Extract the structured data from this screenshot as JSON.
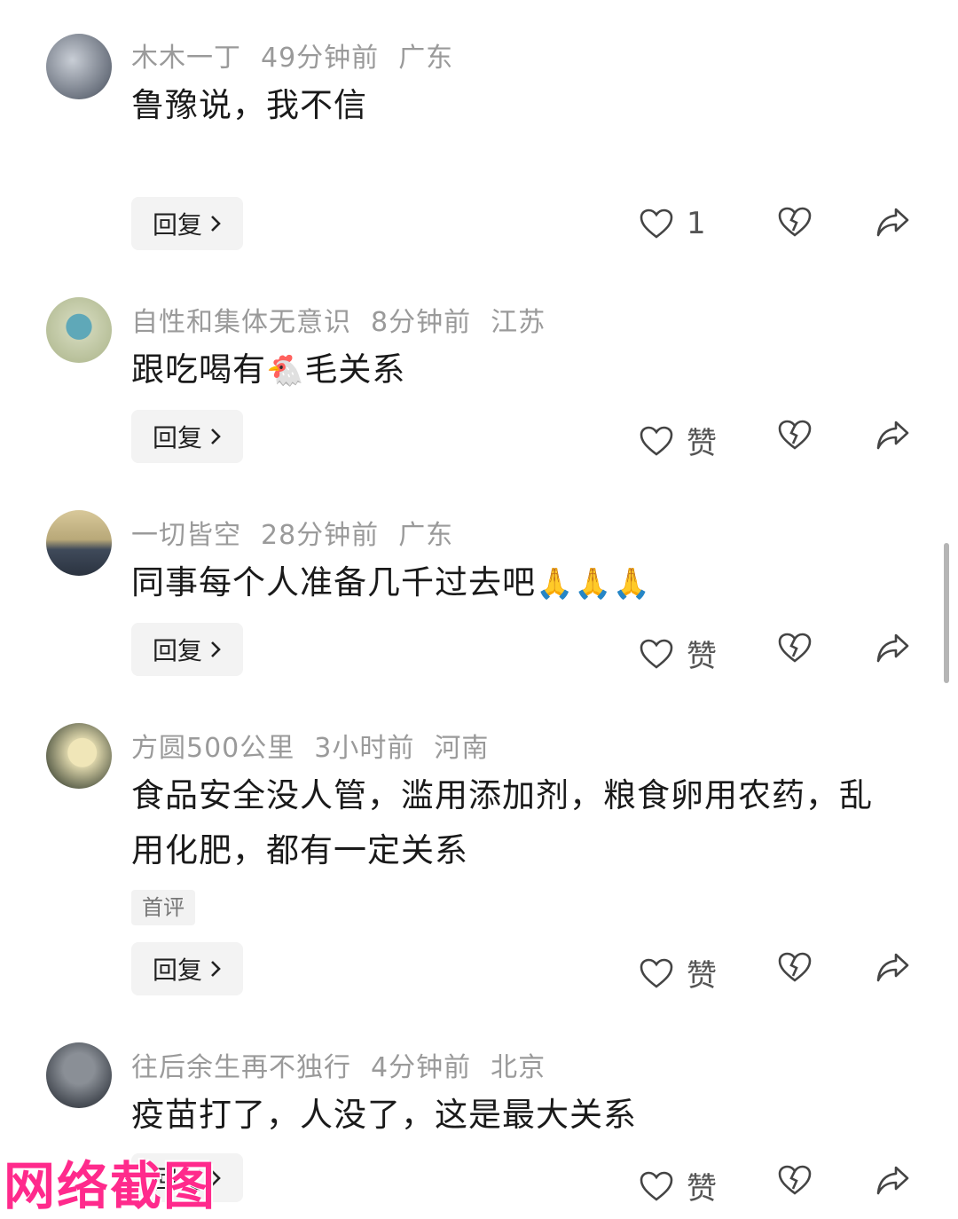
{
  "comments": [
    {
      "author": "木木一丁",
      "time": "49分钟前",
      "location": "广东",
      "text": "鲁豫说，我不信",
      "reply_label": "回复",
      "like_label": "1"
    },
    {
      "author": "自性和集体无意识",
      "time": "8分钟前",
      "location": "江苏",
      "text_before": "跟吃喝有",
      "emoji": "🐔",
      "text_after": "毛关系",
      "reply_label": "回复",
      "like_label": "赞"
    },
    {
      "author": "一切皆空",
      "time": "28分钟前",
      "location": "广东",
      "text": "同事每个人准备几千过去吧",
      "emoji": "🙏🙏🙏",
      "reply_label": "回复",
      "like_label": "赞"
    },
    {
      "author": "方圆500公里",
      "time": "3小时前",
      "location": "河南",
      "text": "食品安全没人管，滥用添加剂，粮食卵用农药，乱用化肥，都有一定关系",
      "tag": "首评",
      "reply_label": "回复",
      "like_label": "赞"
    },
    {
      "author": "往后余生再不独行",
      "time": "4分钟前",
      "location": "北京",
      "text": "疫苗打了，人没了，这是最大关系",
      "reply_label": "回复",
      "like_label": "赞"
    }
  ],
  "icons": {
    "like": "heart-icon",
    "dislike": "broken-heart-icon",
    "share": "share-arrow-icon",
    "reply_chevron": "chevron-right-icon"
  },
  "watermark": "网络截图"
}
